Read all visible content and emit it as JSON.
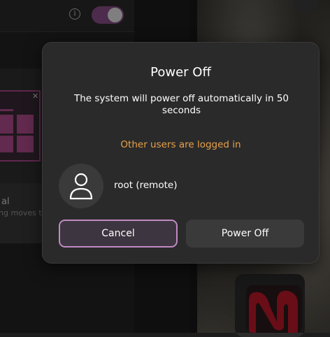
{
  "dialog": {
    "title": "Power Off",
    "message": "The system will power off automatically in 50 seconds",
    "countdown_seconds": 50,
    "warning": "Other users are logged in",
    "user": {
      "name": "root (remote)",
      "avatar_icon": "user-icon"
    },
    "buttons": {
      "cancel": "Cancel",
      "power_off": "Power Off"
    }
  },
  "background": {
    "settings_row_label": "al",
    "settings_row_description": "ng moves th",
    "toggle_on": true
  },
  "colors": {
    "accent": "#c189c3",
    "toggle": "#8d4f8b",
    "warning": "#e9a24a",
    "dialog_bg": "#2a2a2a"
  }
}
